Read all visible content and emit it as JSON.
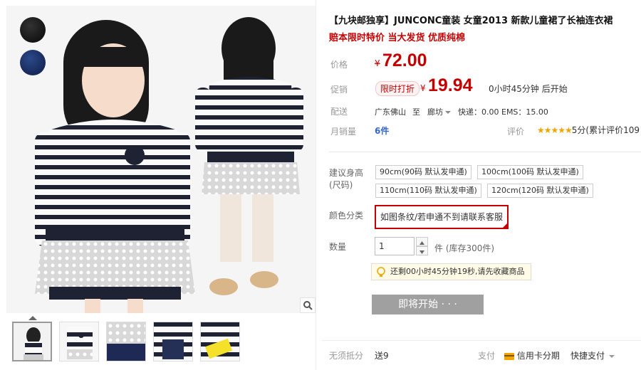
{
  "product": {
    "title": "【九块邮独享】JUNCONC童装 女童2013 新款儿童裙了长袖连衣裙",
    "subtitle": "赔本限时特价 当大发货 优质纯棉",
    "colors": {
      "price_red": "#c40000",
      "link_blue": "#3366cc",
      "star_gold": "#f0a500"
    }
  },
  "gallery": {
    "swatch_icons": [
      "black-color-swatch",
      "navy-color-swatch"
    ],
    "zoom_icon": "magnifier-icon"
  },
  "price": {
    "label": "价格",
    "currency": "¥",
    "value": "72.00"
  },
  "promo": {
    "label": "促销",
    "tag": "限时打折",
    "currency": "¥",
    "value": "19.94",
    "countdown": "0小时45分钟 后开始"
  },
  "shipping": {
    "label": "配送",
    "from": "广东佛山",
    "to_word": "至",
    "to": "廊坊",
    "cost": "快递：0.00 EMS：15.00"
  },
  "sales": {
    "label": "月销量",
    "count": "6件",
    "rating_label": "评价",
    "stars": "★★★★★",
    "rating_text": "5分(累计评价109"
  },
  "size": {
    "label": "建议身高(尺码)",
    "options": [
      "90cm(90码 默认发申通)",
      "100cm(100码 默认发申通)",
      "110cm(110码 默认发申通)",
      "120cm(120码 默认发申通)"
    ]
  },
  "color": {
    "label": "颜色分类",
    "selected": "如图条纹/若申通不到请联系客服"
  },
  "quantity": {
    "label": "数量",
    "value": "1",
    "stock": "件 (库存300件)"
  },
  "notice": {
    "text": "还剩00小时45分钟19秒,请先收藏商品"
  },
  "buy": {
    "label": "即将开始 · · ·"
  },
  "footer": {
    "installment_label": "无须抵分",
    "gift": "送9",
    "pay_label": "支付",
    "credit_card": "信用卡分期",
    "quick_pay": "快捷支付"
  }
}
